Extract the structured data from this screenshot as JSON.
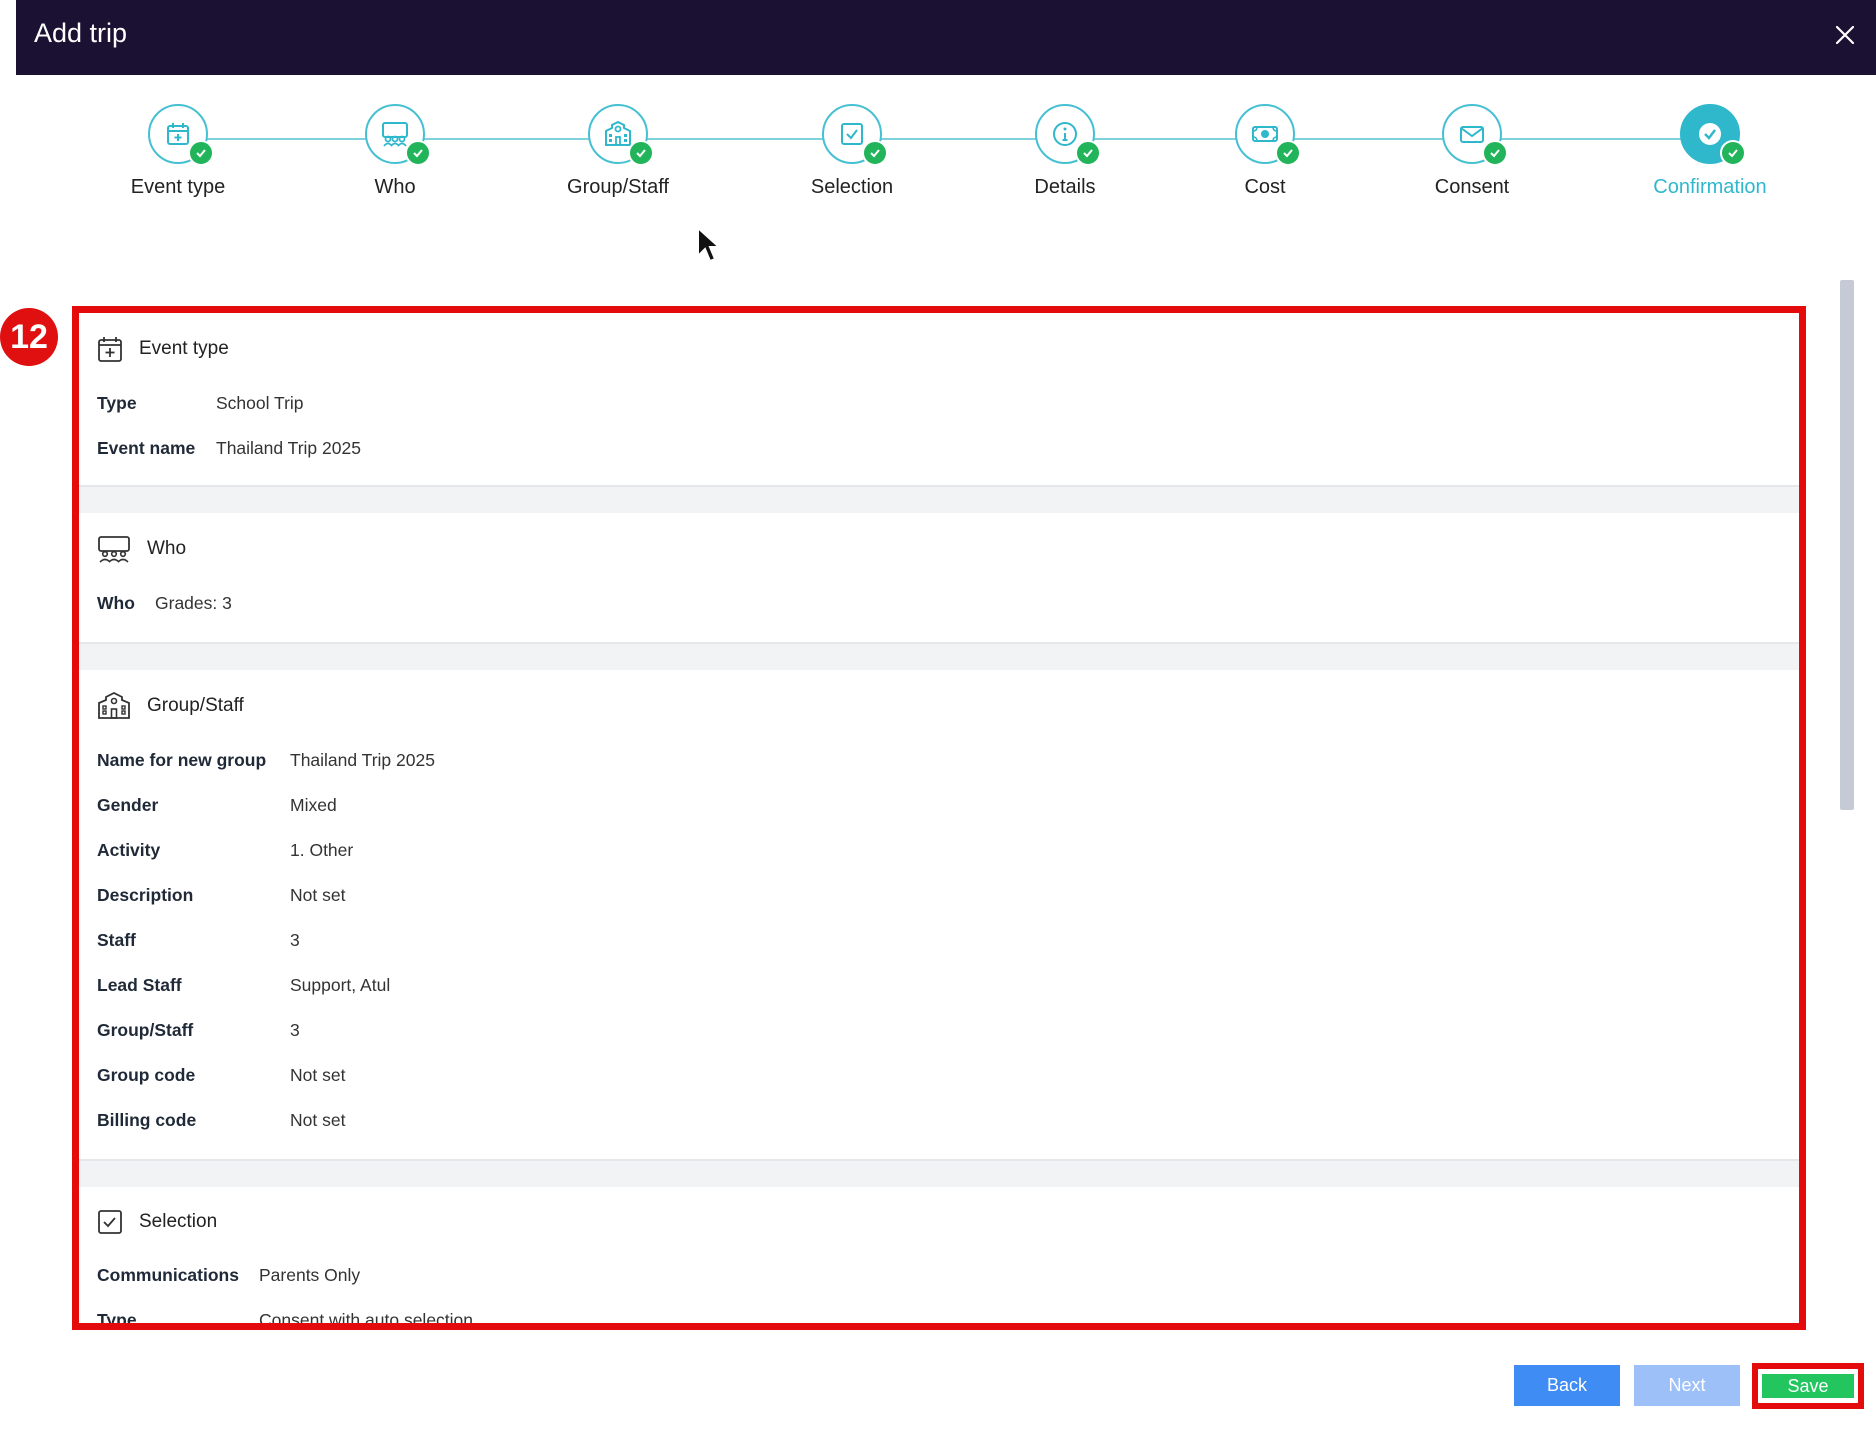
{
  "header": {
    "title": "Add trip",
    "close_icon": "close-icon"
  },
  "stepper": {
    "steps": [
      {
        "label": "Event type",
        "icon": "calendar-plus-icon",
        "completed": true,
        "active": false
      },
      {
        "label": "Who",
        "icon": "people-group-icon",
        "completed": true,
        "active": false
      },
      {
        "label": "Group/Staff",
        "icon": "school-building-icon",
        "completed": true,
        "active": false
      },
      {
        "label": "Selection",
        "icon": "checkbox-icon",
        "completed": true,
        "active": false
      },
      {
        "label": "Details",
        "icon": "info-icon",
        "completed": true,
        "active": false
      },
      {
        "label": "Cost",
        "icon": "money-icon",
        "completed": true,
        "active": false
      },
      {
        "label": "Consent",
        "icon": "envelope-icon",
        "completed": true,
        "active": false
      },
      {
        "label": "Confirmation",
        "icon": "check-circle-icon",
        "completed": true,
        "active": true
      }
    ]
  },
  "annotation_badge": "12",
  "summary": {
    "event_type": {
      "title": "Event type",
      "rows": [
        {
          "key": "Type",
          "value": "School Trip"
        },
        {
          "key": "Event name",
          "value": "Thailand Trip 2025"
        }
      ]
    },
    "who": {
      "title": "Who",
      "rows": [
        {
          "key": "Who",
          "value": "Grades: 3"
        }
      ]
    },
    "group_staff": {
      "title": "Group/Staff",
      "rows": [
        {
          "key": "Name for new group",
          "value": "Thailand Trip 2025"
        },
        {
          "key": "Gender",
          "value": "Mixed"
        },
        {
          "key": "Activity",
          "value": "1. Other"
        },
        {
          "key": "Description",
          "value": "Not set"
        },
        {
          "key": "Staff",
          "value": "3"
        },
        {
          "key": "Lead Staff",
          "value": "Support, Atul"
        },
        {
          "key": "Group/Staff",
          "value": "3"
        },
        {
          "key": "Group code",
          "value": "Not set"
        },
        {
          "key": "Billing code",
          "value": "Not set"
        }
      ]
    },
    "selection": {
      "title": "Selection",
      "rows": [
        {
          "key": "Communications",
          "value": "Parents Only"
        },
        {
          "key": "Type",
          "value": "Consent with auto selection"
        }
      ]
    }
  },
  "footer": {
    "back_label": "Back",
    "next_label": "Next",
    "save_label": "Save"
  },
  "colors": {
    "header_bg": "#1b1133",
    "accent": "#2fb8cc",
    "check_green": "#22b45a",
    "highlight_red": "#e30b0b",
    "back_blue": "#3f8cf5",
    "next_blue_disabled": "#9cc0f7",
    "save_green": "#22c55e"
  }
}
